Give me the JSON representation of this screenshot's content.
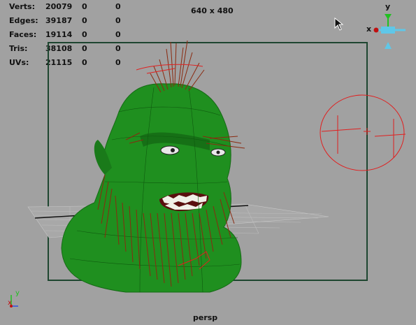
{
  "hud": {
    "rows": [
      {
        "label": "Verts:",
        "v1": "20079",
        "v2": "0",
        "v3": "0"
      },
      {
        "label": "Edges:",
        "v1": "39187",
        "v2": "0",
        "v3": "0"
      },
      {
        "label": "Faces:",
        "v1": "19114",
        "v2": "0",
        "v3": "0"
      },
      {
        "label": "Tris:",
        "v1": "38108",
        "v2": "0",
        "v3": "0"
      },
      {
        "label": "UVs:",
        "v1": "21115",
        "v2": "0",
        "v3": "0"
      }
    ]
  },
  "viewport": {
    "resolution": "640 x 480",
    "camera": "persp"
  },
  "view_cube": {
    "x_label": "x",
    "y_label": "y"
  },
  "axis_indicator": {
    "x_label": "x",
    "y_label": "y"
  },
  "colors": {
    "background": "#a1a1a1",
    "mesh_green": "#1f8f1f",
    "hair_red": "#8a2a10",
    "curve_red": "#e02020",
    "gate": "#1e4630"
  }
}
